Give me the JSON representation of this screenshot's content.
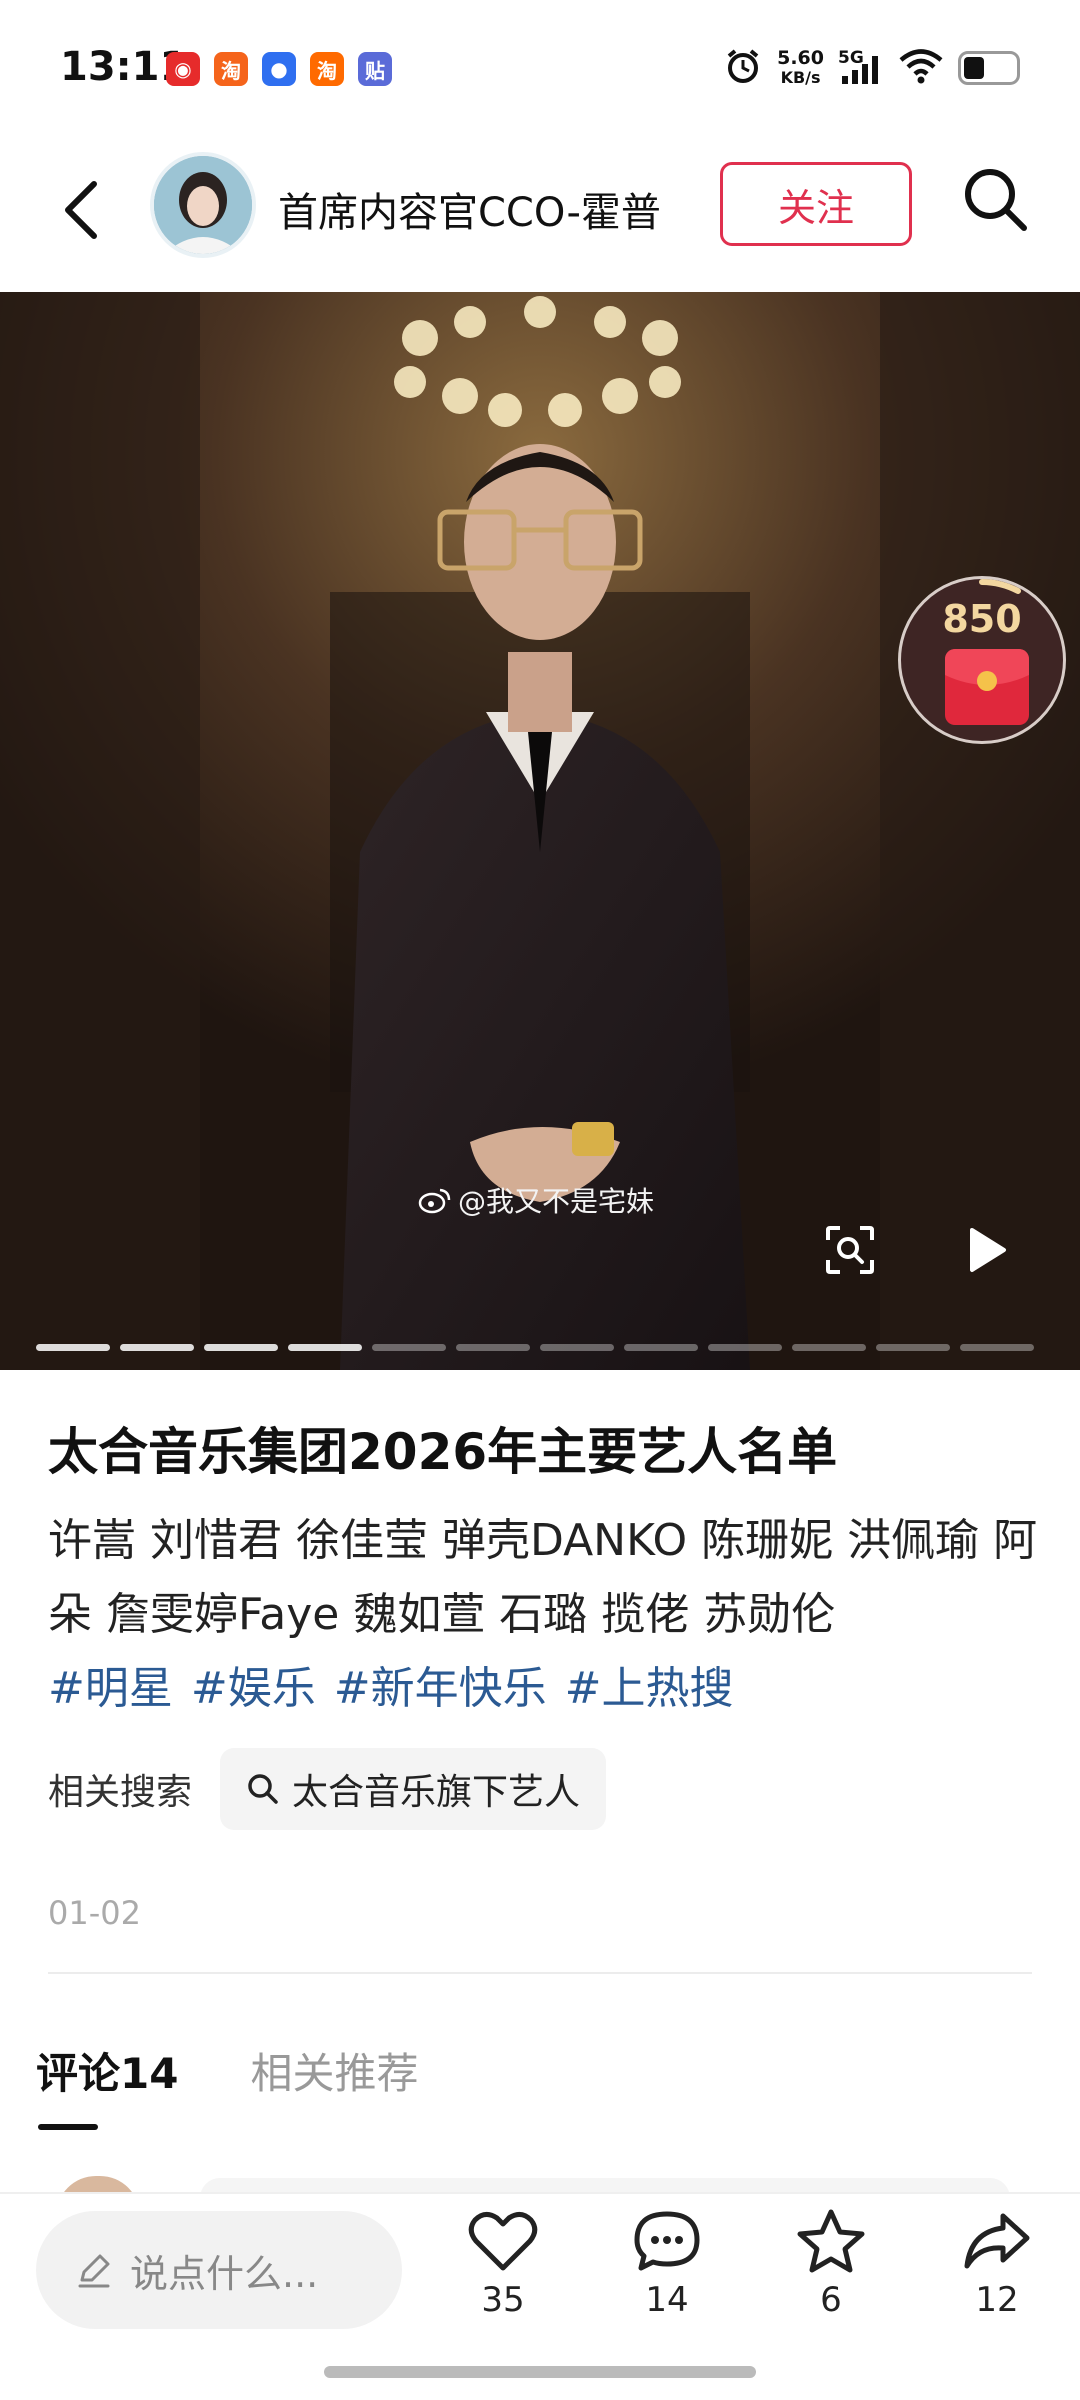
{
  "status_bar": {
    "time": "13:11",
    "notifications": [
      {
        "icon": "netease-music-icon",
        "glyph": "◉",
        "color": "#e62b2b"
      },
      {
        "icon": "taobao-icon",
        "glyph": "淘",
        "color": "#f5641b"
      },
      {
        "icon": "browser-icon",
        "glyph": "●",
        "color": "#2f6ff0"
      },
      {
        "icon": "taobao-tmall-icon",
        "glyph": "淘",
        "color": "#ff6a00"
      },
      {
        "icon": "tieba-icon",
        "glyph": "贴",
        "color": "#5a6bd8"
      }
    ],
    "net_speed": "5.60",
    "net_speed_unit": "KB/s",
    "signal_label": "5G"
  },
  "header": {
    "author_name": "首席内容官CCO-霍普",
    "follow_label": "关注"
  },
  "media": {
    "watermark": "@我又不是宅妹",
    "page_count": 12,
    "active_page": 4,
    "redpack_count": "850"
  },
  "post": {
    "title": "太合音乐集团2026年主要艺人名单",
    "body": "许嵩 刘惜君 徐佳莹 弹壳DANKO 陈珊妮 洪佩瑜 阿朵 詹雯婷Faye 魏如萱 石璐 揽佬 苏勋伦",
    "tags": [
      "#明星",
      "#娱乐",
      "#新年快乐",
      "#上热搜"
    ],
    "related_label": "相关搜索",
    "related_query": "太合音乐旗下艺人",
    "date": "01-02"
  },
  "tabs": [
    {
      "label": "评论14",
      "active": true
    },
    {
      "label": "相关推荐",
      "active": false
    }
  ],
  "bottom_bar": {
    "comment_placeholder": "说点什么...",
    "likes": "35",
    "comments": "14",
    "favorites": "6",
    "shares": "12"
  },
  "colors": {
    "accent": "#e0304e",
    "tag": "#2b5a93"
  }
}
